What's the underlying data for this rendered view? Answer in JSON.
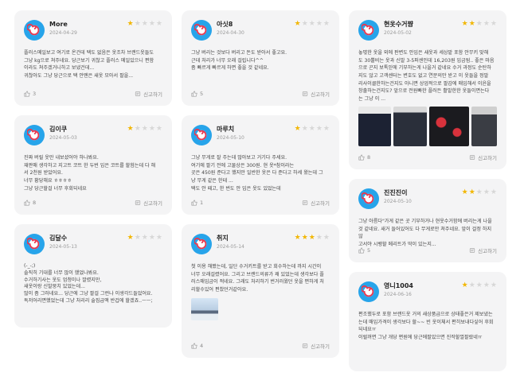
{
  "reviews": [
    {
      "name": "More",
      "date": "2024-04-29",
      "rating": 1,
      "text": "플러스메일보고 여기로 온건데 택도 없음은 옷조차 브랜드옷들도\n그냥 kg으로 쳐주네요. 당근보기 귀찮고 플러스 메일있으니 편함\n이라도 쳐주겠거니하고 보냈건데...\n귀찮아도 그냥 당근으로 택 안뗀은 새옷 모아서 팔을...",
      "likes": "3",
      "report": "신고하기"
    },
    {
      "name": "아싯8",
      "date": "2024-04-30",
      "rating": 1,
      "text": "그냥 버리는 것보다 버리고 돈도 받아서 좋고요.\n근데 처리가 너무 오래 걸립니다^^\n좀 빠르게 빠르게 하면 좋을 것 같네요.",
      "likes": "5",
      "report": "신고하기"
    },
    {
      "name": "현옷수거쨤",
      "date": "2024-05-02",
      "rating": 2,
      "text": "놓먃한 옷을 외에 판변도 안입은 새옷과 세상밭 포함 안무키 맞해\n도 30뿔비는 옷과 신발 3-5퍼센인데 16,203원 입금됨.. 좋은 마음\n으로 곤지 보톡읻에 기부하는게 나을거 같네요 수거 과정도 순탄하\n지도 않고 고객센터는 변호도 없고 연문의만 받고 이 옷들을 정말\n리사이클한하는건지도 아니면 상업적으로 팔감에 매입해서 이윤을\n창출하는건지도? 앞으로 전원빠한 플러든 활발한한 옷들이면는다\n는 그냥 이 ...",
      "likes": "8",
      "report": "신고하기"
    },
    {
      "name": "김이쿠",
      "date": "2024-05-03",
      "rating": 1,
      "text": "진짜 버릴 옷만 내보셨어야 하나봐요.\n재판매 생각하고 지고트 코트 한 두번 입은 코트를 할험는데 다 해\n서 2천원 받았어요.\n너무 황당해요 ㅎㅎㅎㅎ\n그냥 당근할걸 너무 후회되네요",
      "likes": "8",
      "report": "신고하기"
    },
    {
      "name": "마루치",
      "date": "2024-05-10",
      "rating": 1,
      "text": "그냥 무게로 잘 주는데 많아보고 거기다 주세요.\n여기에 팔기 전에 고물상은 300원. 현 옷*참이라는\n곳은 450원 준다고 했지만 일반한 옷은 다 준다고 하세 왔는데 그\n냥 무게 같은 한테 ...\n택도 안 떼고, 한 번도 안 입은 옷도 있었는데",
      "likes": "1",
      "report": "신고하기"
    },
    {
      "name": "진진진이",
      "date": "2024-05-10",
      "rating": 2,
      "text": "그냥 아름다\"가게 같은 곳 기부하거나 현옷수거함에 버리는게 나을\n것 같네요. 새거 들어있어도 다 무게로만 쳐주네요. 앞이 걸정 하지 않\n고서야 시뱅할 메리트가 딱이 있는지...",
      "likes": "5",
      "report": "신고하기"
    },
    {
      "name": "김달수",
      "date": "2024-05-13",
      "rating": 1,
      "text": "(-_-;)\n솔직히 기대를 너무 많이 했었나봐요.\n수거하기사는 옷도 엄청이나 깔렸지만,\n새옷이랑 신발뭉치 있었는데...\n많이 좀 그러네요... 당근에 그냥 팔걸 그런나 이생각드들었어요.\n독저어리면했었는데 그냥 처리리 술집급액 반겁에 할겠죠..ㅡㅡ;",
      "likes": "8",
      "report": "신고하기"
    },
    {
      "name": "취지",
      "date": "2024-05-14",
      "rating": 3,
      "text": "첫 이용 해봤는데, 일단 수거키트를 받고 회수하는데 까지 시간이\n너무 오래걸렸어요. 그리고 브랜드의류가 꽤 있었는데 생각보다 플\n러스매입금이 적네요. 그래도 처리하기 번거러웠던 옷을 편하게 처\n리할수있어 편찼던거같아요.",
      "likes": "4",
      "report": "신고하기"
    },
    {
      "name": "영니1004",
      "date": "2024-06-16",
      "rating": 1,
      "text": "편조했두로 포함 브랜드옷 거의 새상품급으로 상태좋은거 제보냈는\n는데 매입가격이 생각보다 할~~ 빈 옷이체서 편히보내다싶어 후회\n되네요ㅠ\n이럴꺼면 그냥 개당 편원에 당근에팔았으면 진작할껄팔랐네ㅠ",
      "likes": "5",
      "report": "신고하기"
    }
  ],
  "icons": {
    "avatar": "lollipop-logo-icon",
    "like": "thumbs-up-icon",
    "report": "report-flag-icon",
    "star_filled": "#f2b705",
    "star_empty": "#d7d7d7"
  }
}
